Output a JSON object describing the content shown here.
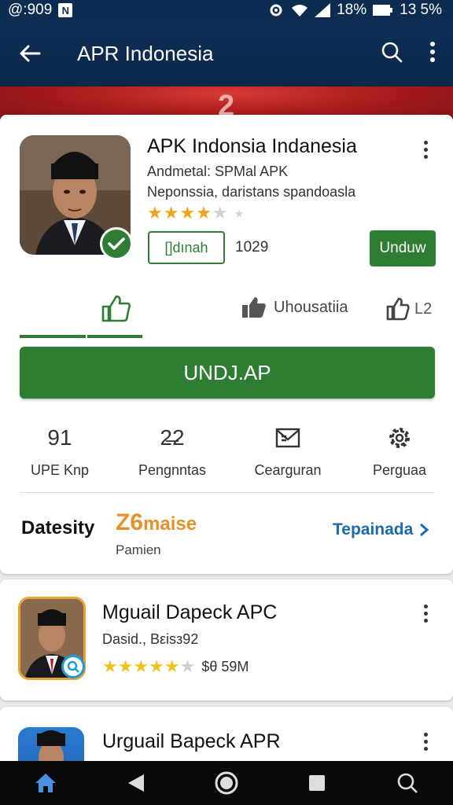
{
  "status_bar": {
    "time": "@:909",
    "nfc": "N",
    "battery_pct": "18%",
    "right_text": "13 5%"
  },
  "app_bar": {
    "title": "APR Indonesia",
    "icons": [
      "back-arrow-icon",
      "search-icon",
      "more-vert-icon"
    ]
  },
  "banner": {
    "number": "2",
    "colors": [
      "#d83a34",
      "#a3191a"
    ]
  },
  "featured": {
    "name": "APK Indonsia Indanesia",
    "meta_line1": "Andmetal: SPMal APK",
    "meta_line2": "Neponssia, daristans spandoasla",
    "rating_stars": 4,
    "chip_label": "[]dınah",
    "count": "1029",
    "install_label": "Unduw"
  },
  "reactions": {
    "middle_label": "Uhousatiia",
    "right_label": "L2"
  },
  "big_button": {
    "label": "UNDJ.AP"
  },
  "stats": [
    {
      "icon": "91",
      "label": "UPE Knp"
    },
    {
      "icon": "2̶2",
      "label": "Pengnntas"
    },
    {
      "icon": "envelope-grid-icon",
      "label": "Cearguran"
    },
    {
      "icon": "gear-icon",
      "label": "Perguaa"
    }
  ],
  "datesity": {
    "label": "Datesity",
    "count": "Z6",
    "unit": "maise",
    "sub": "Pamien",
    "link": "Tepainada"
  },
  "list": [
    {
      "name": "Mguail Dapeck APC",
      "sub": "Dasid., Bεisз92",
      "rating_stars": 4.5,
      "extra": "$θ  59M"
    },
    {
      "name": "Urguail Bapeck APR"
    }
  ],
  "colors": {
    "primary_green": "#2e7d32",
    "app_bar_blue": "#0f2f57",
    "accent_orange": "#e8912a",
    "link_blue": "#1a6ab0",
    "star_gold": "#f2a31c"
  }
}
